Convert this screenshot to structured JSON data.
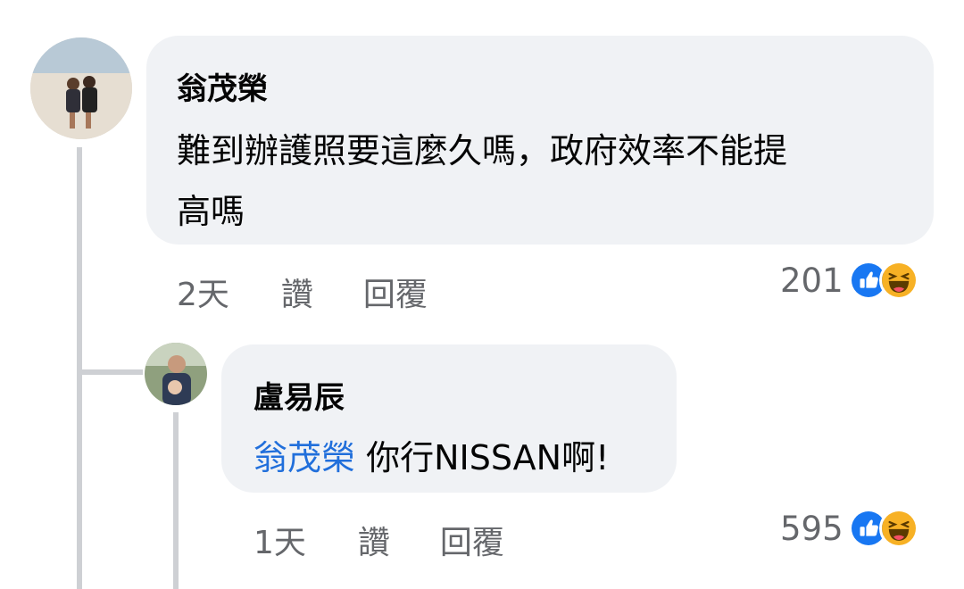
{
  "comments": [
    {
      "author": "翁茂榮",
      "text_line1": "難到辦護照要這麼久嗎，政府效率不能提",
      "text_line2": "高嗎",
      "time": "2天",
      "like_label": "讚",
      "reply_label": "回覆",
      "reaction_count": "201",
      "reactions": [
        "like-icon",
        "haha-icon"
      ]
    },
    {
      "author": "盧易辰",
      "mention": "翁茂榮",
      "text": " 你行NISSAN啊!",
      "time": "1天",
      "like_label": "讚",
      "reply_label": "回覆",
      "reaction_count": "595",
      "reactions": [
        "like-icon",
        "haha-icon"
      ]
    }
  ],
  "colors": {
    "bubble": "#f0f2f5",
    "mention": "#216fdb",
    "secondary_text": "#65676b",
    "like_blue": "#1877f2",
    "haha_yellow": "#f7b125",
    "thread_line": "#ced0d4"
  }
}
